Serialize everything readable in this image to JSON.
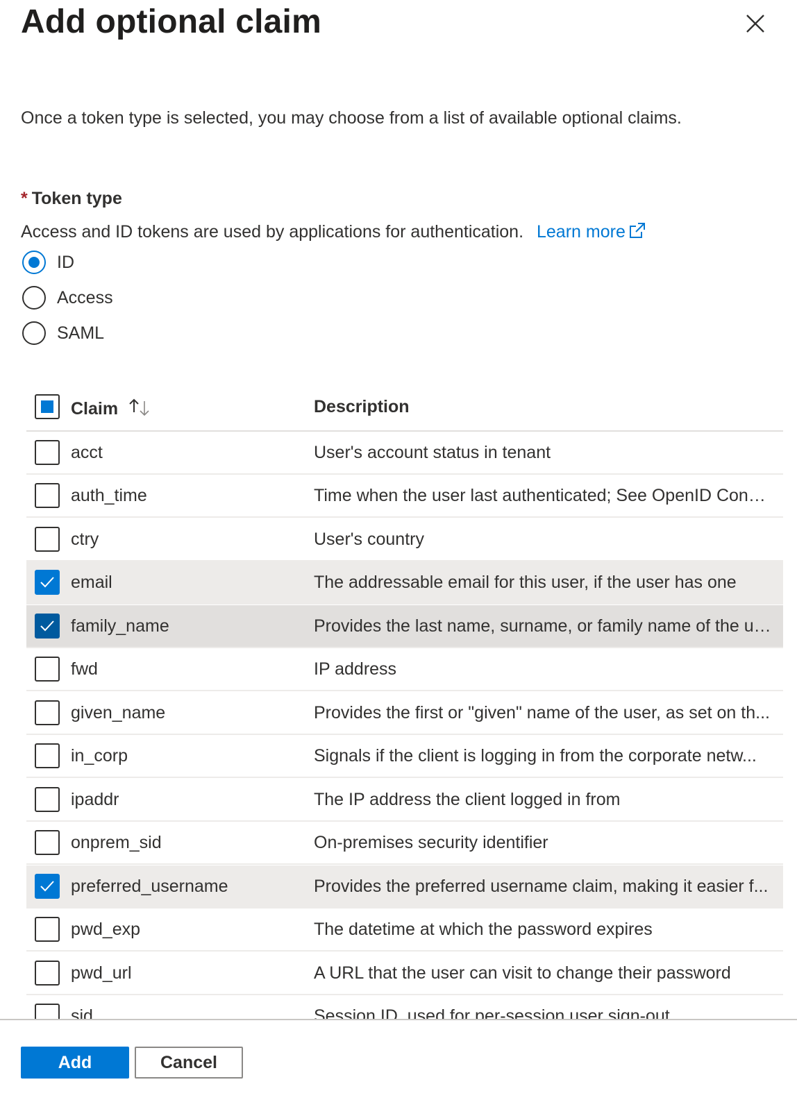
{
  "panel": {
    "title": "Add optional claim",
    "intro": "Once a token type is selected, you may choose from a list of available optional claims."
  },
  "token_type": {
    "required_marker": "*",
    "label": "Token type",
    "help": "Access and ID tokens are used by applications for authentication.",
    "learn_more": "Learn more",
    "options": [
      {
        "label": "ID",
        "selected": true
      },
      {
        "label": "Access",
        "selected": false
      },
      {
        "label": "SAML",
        "selected": false
      }
    ]
  },
  "grid": {
    "columns": {
      "claim": "Claim",
      "description": "Description"
    },
    "select_all_state": "indeterminate",
    "rows": [
      {
        "claim": "acct",
        "description": "User's account status in tenant",
        "checked": false
      },
      {
        "claim": "auth_time",
        "description": "Time when the user last authenticated; See OpenID Conn...",
        "checked": false
      },
      {
        "claim": "ctry",
        "description": "User's country",
        "checked": false
      },
      {
        "claim": "email",
        "description": "The addressable email for this user, if the user has one",
        "checked": true
      },
      {
        "claim": "family_name",
        "description": "Provides the last name, surname, or family name of the us...",
        "checked": true
      },
      {
        "claim": "fwd",
        "description": "IP address",
        "checked": false
      },
      {
        "claim": "given_name",
        "description": "Provides the first or \"given\" name of the user, as set on th...",
        "checked": false
      },
      {
        "claim": "in_corp",
        "description": "Signals if the client is logging in from the corporate netw...",
        "checked": false
      },
      {
        "claim": "ipaddr",
        "description": "The IP address the client logged in from",
        "checked": false
      },
      {
        "claim": "onprem_sid",
        "description": "On-premises security identifier",
        "checked": false
      },
      {
        "claim": "preferred_username",
        "description": "Provides the preferred username claim, making it easier f...",
        "checked": true
      },
      {
        "claim": "pwd_exp",
        "description": "The datetime at which the password expires",
        "checked": false
      },
      {
        "claim": "pwd_url",
        "description": "A URL that the user can visit to change their password",
        "checked": false
      },
      {
        "claim": "sid",
        "description": "Session ID, used for per-session user sign-out",
        "checked": false
      }
    ]
  },
  "footer": {
    "add_label": "Add",
    "cancel_label": "Cancel"
  },
  "colors": {
    "accent": "#0078d4",
    "required": "#a4262c",
    "selected_row": "#edebe9"
  }
}
